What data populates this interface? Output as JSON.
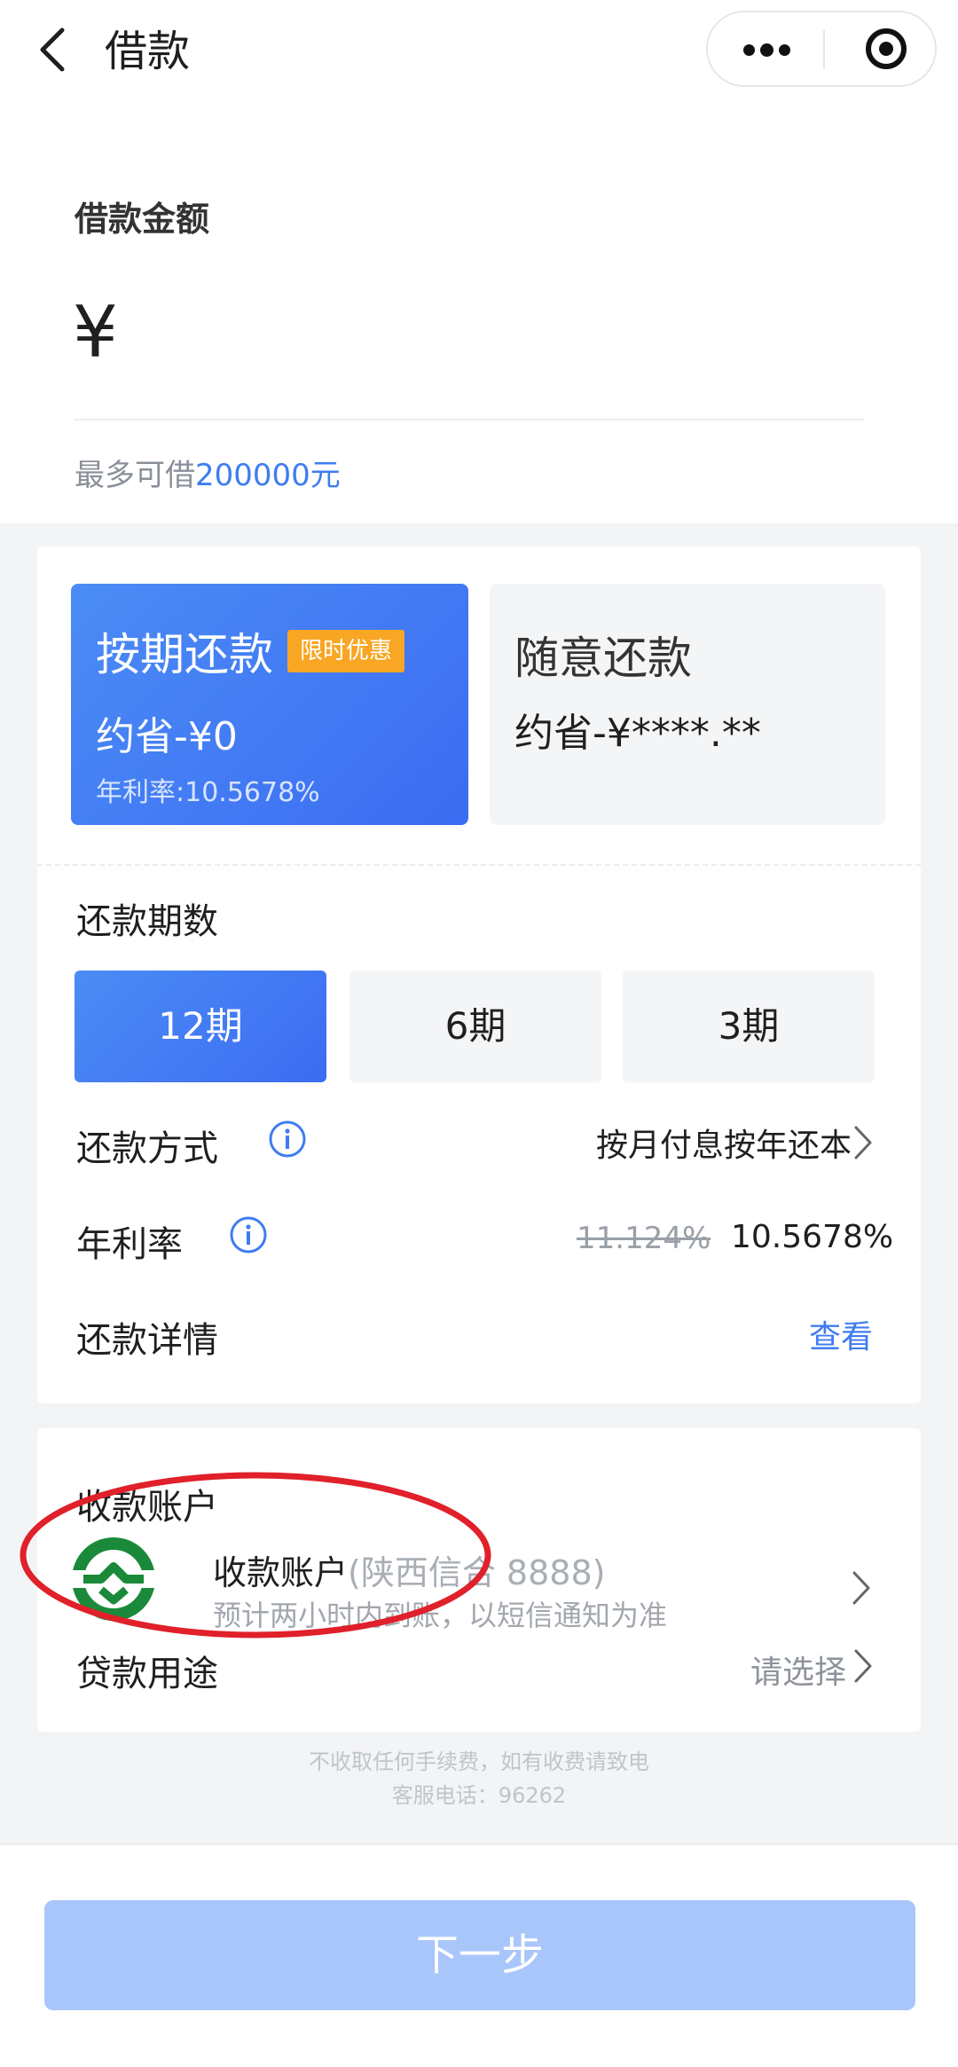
{
  "header": {
    "title": "借款"
  },
  "amount": {
    "label": "借款金额",
    "currency_symbol": "¥",
    "input_value": "",
    "max_prefix": "最多可借",
    "max_amount": "200000元"
  },
  "plans": [
    {
      "title": "按期还款",
      "badge": "限时优惠",
      "save": "约省-¥0",
      "rate": "年利率:10.5678%",
      "selected": true
    },
    {
      "title": "随意还款",
      "save": "约省-¥****.**",
      "selected": false
    }
  ],
  "periods": {
    "label": "还款期数",
    "options": [
      {
        "label": "12期",
        "selected": true
      },
      {
        "label": "6期",
        "selected": false
      },
      {
        "label": "3期",
        "selected": false
      }
    ]
  },
  "repayment_method": {
    "label": "还款方式",
    "value": "按月付息按年还本"
  },
  "annual_rate": {
    "label": "年利率",
    "original": "11.124%",
    "current": "10.5678%"
  },
  "repayment_details": {
    "label": "还款详情",
    "link": "查看"
  },
  "account": {
    "section_label": "收款账户",
    "title": "收款账户",
    "bank": "(陕西信合 8888)",
    "note": "预计两小时内到账，以短信通知为准"
  },
  "purpose": {
    "label": "贷款用途",
    "value": "请选择"
  },
  "footer": {
    "line1": "不收取任何手续费，如有收费请致电",
    "line2": "客服电话：96262"
  },
  "next_button": "下一步",
  "colors": {
    "accent": "#3f7cf0",
    "badge": "#f8a623",
    "button_disabled": "#a9c6fb",
    "logo_green": "#1a8a3a",
    "annotation_red": "#e0202a"
  }
}
